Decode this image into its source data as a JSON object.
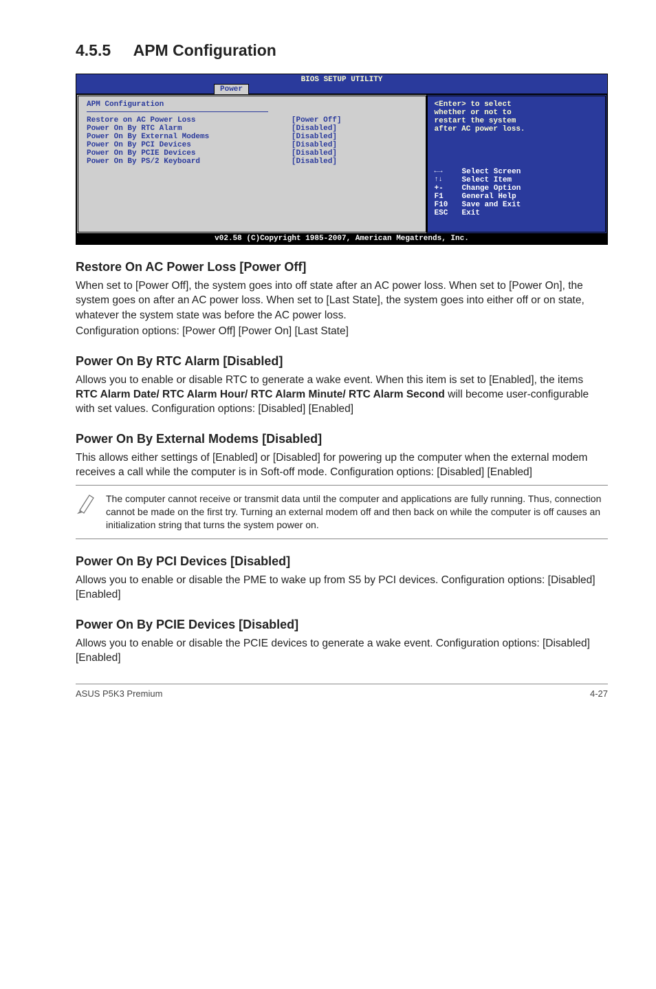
{
  "section": {
    "number": "4.5.5",
    "title": "APM Configuration"
  },
  "bios": {
    "title": "BIOS SETUP UTILITY",
    "tab": "Power",
    "group_title": "APM Configuration",
    "rows": [
      {
        "label": "Restore on AC Power Loss",
        "value": "[Power Off]"
      },
      {
        "label": "Power On By RTC Alarm",
        "value": "[Disabled]"
      },
      {
        "label": "Power On By External Modems",
        "value": "[Disabled]"
      },
      {
        "label": "Power On By PCI Devices",
        "value": "[Disabled]"
      },
      {
        "label": "Power On By PCIE Devices",
        "value": "[Disabled]"
      },
      {
        "label": "Power On By PS/2 Keyboard",
        "value": "[Disabled]"
      }
    ],
    "help": {
      "line1": "<Enter> to select",
      "line2": "whether or not to",
      "line3": "restart the system",
      "line4": "after AC power loss."
    },
    "nav": {
      "arrows_lr": "←→",
      "lr_label": "Select Screen",
      "arrows_ud": "↑↓",
      "ud_label": "Select Item",
      "plusminus": "+-",
      "pm_label": "Change Option",
      "f1": "F1",
      "f1_label": "General Help",
      "f10": "F10",
      "f10_label": "Save and Exit",
      "esc": "ESC",
      "esc_label": "Exit"
    },
    "footer": "v02.58 (C)Copyright 1985-2007, American Megatrends, Inc."
  },
  "s1": {
    "heading": "Restore On AC Power Loss [Power Off]",
    "p1": "When set to [Power Off], the system goes into off state after an AC power loss. When set to [Power On], the system goes on after an AC power loss. When set to [Last State], the system goes into either off or on state, whatever the system state was before the AC power loss.",
    "p2": "Configuration options: [Power Off] [Power On] [Last State]"
  },
  "s2": {
    "heading": "Power On By RTC Alarm [Disabled]",
    "p1a": "Allows you to enable or disable RTC to generate a wake event. When this item is set to [Enabled], the items ",
    "p1bold": "RTC Alarm Date/ RTC Alarm Hour/ RTC Alarm Minute/ RTC Alarm Second",
    "p1b": " will become user-configurable with set values. Configuration options: [Disabled] [Enabled]"
  },
  "s3": {
    "heading": "Power On By External Modems [Disabled]",
    "p1": "This allows either settings of [Enabled] or [Disabled] for powering up the computer when the external modem receives a call while the computer is in Soft-off mode. Configuration options: [Disabled] [Enabled]"
  },
  "note": {
    "text": "The computer cannot receive or transmit data until the computer and applications are fully running. Thus, connection cannot be made on the first try. Turning an external modem off and then back on while the computer is off causes an initialization string that turns the system power on."
  },
  "s4": {
    "heading": "Power On By PCI Devices [Disabled]",
    "p1": "Allows you to enable or disable the PME to wake up from S5 by PCI devices. Configuration options: [Disabled] [Enabled]"
  },
  "s5": {
    "heading": "Power On By PCIE Devices [Disabled]",
    "p1": "Allows you to enable or disable the PCIE devices to generate a wake event. Configuration options: [Disabled] [Enabled]"
  },
  "footer": {
    "left": "ASUS P5K3 Premium",
    "right": "4-27"
  }
}
